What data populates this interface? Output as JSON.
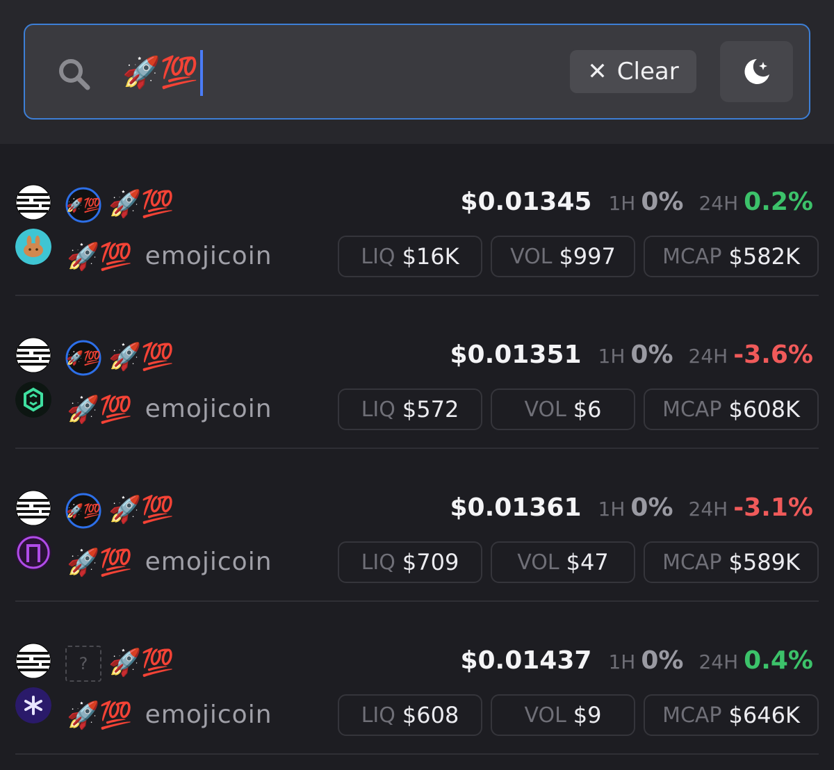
{
  "search": {
    "value": "🚀💯",
    "clear_label": "Clear"
  },
  "results": [
    {
      "token_symbol": "🚀💯",
      "base_symbol": "🚀💯",
      "base_name": "emojicoin",
      "price": "$0.01345",
      "h1_label": "1H",
      "h1_change": "0%",
      "h24_label": "24H",
      "h24_change": "0.2%",
      "h24_trend": "up",
      "liq_label": "LIQ",
      "liq_value": "$16K",
      "vol_label": "VOL",
      "vol_value": "$997",
      "mcap_label": "MCAP",
      "mcap_value": "$582K",
      "dex_icon": "pancakeswap-icon",
      "token_icon": "rocket-100-icon",
      "accent": "#3cc26a"
    },
    {
      "token_symbol": "🚀💯",
      "base_symbol": "🚀💯",
      "base_name": "emojicoin",
      "price": "$0.01351",
      "h1_label": "1H",
      "h1_change": "0%",
      "h24_label": "24H",
      "h24_change": "-3.6%",
      "h24_trend": "down",
      "liq_label": "LIQ",
      "liq_value": "$572",
      "vol_label": "VOL",
      "vol_value": "$6",
      "mcap_label": "MCAP",
      "mcap_value": "$608K",
      "dex_icon": "cellana-icon",
      "token_icon": "rocket-100-icon",
      "accent": "#f05a5a"
    },
    {
      "token_symbol": "🚀💯",
      "base_symbol": "🚀💯",
      "base_name": "emojicoin",
      "price": "$0.01361",
      "h1_label": "1H",
      "h1_change": "0%",
      "h24_label": "24H",
      "h24_change": "-3.1%",
      "h24_trend": "down",
      "liq_label": "LIQ",
      "liq_value": "$709",
      "vol_label": "VOL",
      "vol_value": "$47",
      "mcap_label": "MCAP",
      "mcap_value": "$589K",
      "dex_icon": "hyperion-icon",
      "token_icon": "rocket-100-icon",
      "accent": "#f05a5a"
    },
    {
      "token_symbol": "🚀💯",
      "base_symbol": "🚀💯",
      "base_name": "emojicoin",
      "price": "$0.01437",
      "h1_label": "1H",
      "h1_change": "0%",
      "h24_label": "24H",
      "h24_change": "0.4%",
      "h24_trend": "up",
      "liq_label": "LIQ",
      "liq_value": "$608",
      "vol_label": "VOL",
      "vol_value": "$9",
      "mcap_label": "MCAP",
      "mcap_value": "$646K",
      "dex_icon": "tapp-icon",
      "token_icon": "unknown-token-icon",
      "placeholder_char": "?",
      "accent": "#3cc26a"
    }
  ],
  "colors": {
    "up": "#3cc26a",
    "down": "#f05a5a",
    "search_border": "#3d7fd6",
    "caret": "#4a7cf7"
  }
}
